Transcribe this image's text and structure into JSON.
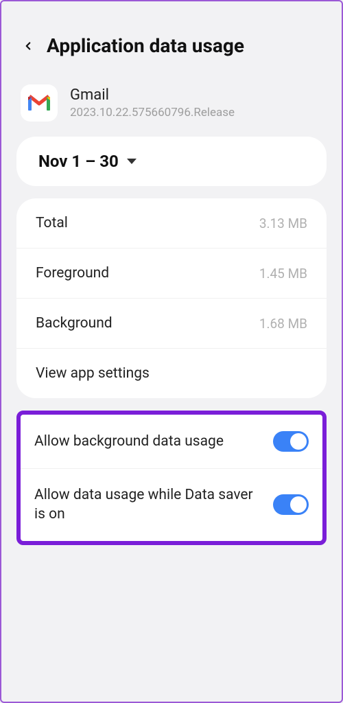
{
  "header": {
    "title": "Application data usage"
  },
  "app": {
    "name": "Gmail",
    "version": "2023.10.22.575660796.Release"
  },
  "period": {
    "label": "Nov 1 – 30"
  },
  "stats": {
    "total_label": "Total",
    "total_value": "3.13 MB",
    "foreground_label": "Foreground",
    "foreground_value": "1.45 MB",
    "background_label": "Background",
    "background_value": "1.68 MB",
    "view_settings_label": "View app settings"
  },
  "toggles": {
    "bg_data_label": "Allow background data usage",
    "data_saver_label": "Allow data usage while Data saver is on"
  }
}
